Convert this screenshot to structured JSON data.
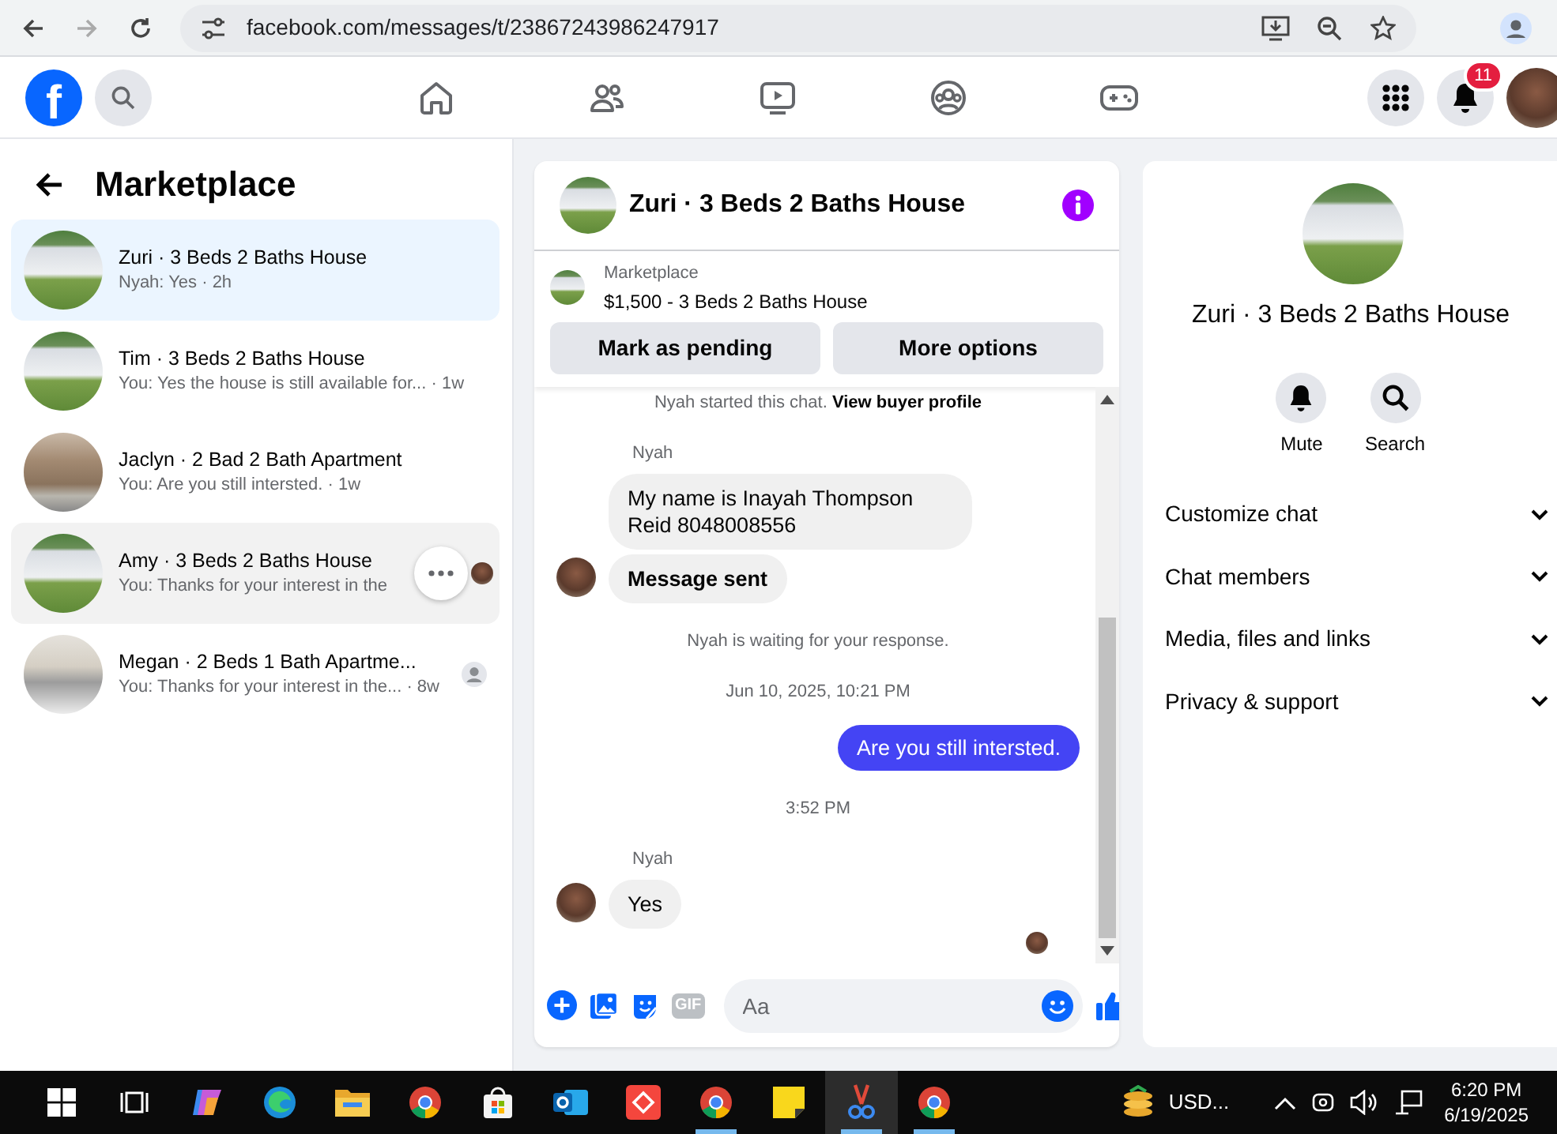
{
  "browser": {
    "url": "facebook.com/messages/t/23867243986247917"
  },
  "header": {
    "logo": "f",
    "notification_count": "11",
    "nav": [
      {
        "kind": "home",
        "selected": false
      },
      {
        "kind": "friends",
        "selected": false
      },
      {
        "kind": "video",
        "selected": false
      },
      {
        "kind": "groups",
        "selected": false
      },
      {
        "kind": "gaming",
        "selected": false
      }
    ]
  },
  "sidebar": {
    "title": "Marketplace",
    "conversations": [
      {
        "kind": "house",
        "title": "Zuri · 3 Beds 2 Baths House",
        "preview": "Nyah: Yes · 2h",
        "selected": true,
        "hovered": false,
        "read": false,
        "delivered": false
      },
      {
        "kind": "house",
        "title": "Tim · 3 Beds 2 Baths House",
        "preview": "You: Yes the house is still available for... · 1w",
        "selected": false,
        "hovered": false,
        "read": false,
        "delivered": false
      },
      {
        "kind": "apartment",
        "title": "Jaclyn · 2 Bad 2 Bath Apartment",
        "preview": "You: Are you still intersted. · 1w",
        "selected": false,
        "hovered": false,
        "read": false,
        "delivered": false
      },
      {
        "kind": "house",
        "title": "Amy · 3 Beds 2 Baths House",
        "preview": "You: Thanks for your interest in the",
        "selected": false,
        "hovered": true,
        "read": true,
        "delivered": false
      },
      {
        "kind": "kitchen",
        "title": "Megan · 2 Beds 1 Bath Apartme...",
        "preview": "You: Thanks for your interest in the... · 8w",
        "selected": false,
        "hovered": false,
        "read": false,
        "delivered": true
      }
    ]
  },
  "chat": {
    "title": "Zuri · 3 Beds 2 Baths House",
    "listing": {
      "label": "Marketplace",
      "price_title": "$1,500 - 3 Beds 2 Baths House",
      "buttons": [
        "Mark as pending",
        "More options"
      ]
    },
    "messages": [
      {
        "kind": "notice",
        "text": "Nyah started this chat.",
        "link": "View buyer profile"
      },
      {
        "kind": "sender",
        "text": "Nyah"
      },
      {
        "kind": "incoming",
        "text": "My name is Inayah Thompson Reid 8048008556",
        "avatar": false,
        "bold": false
      },
      {
        "kind": "incoming",
        "text": "Message sent",
        "avatar": true,
        "bold": true
      },
      {
        "kind": "notice",
        "text": "Nyah is waiting for your response."
      },
      {
        "kind": "timestamp",
        "text": "Jun 10, 2025, 10:21 PM"
      },
      {
        "kind": "outgoing",
        "text": "Are you still intersted."
      },
      {
        "kind": "timestamp",
        "text": "3:52 PM"
      },
      {
        "kind": "sender",
        "text": "Nyah"
      },
      {
        "kind": "incoming",
        "text": "Yes",
        "avatar": true,
        "bold": false
      },
      {
        "kind": "seen"
      }
    ],
    "composer": {
      "gif_label": "GIF",
      "placeholder": "Aa"
    }
  },
  "info_panel": {
    "title": "Zuri · 3 Beds 2 Baths House",
    "actions": [
      {
        "kind": "mute",
        "label": "Mute"
      },
      {
        "kind": "search",
        "label": "Search"
      }
    ],
    "sections": [
      {
        "label": "Customize chat",
        "expanded": false
      },
      {
        "label": "Chat members",
        "expanded": false
      },
      {
        "label": "Media, files and links",
        "expanded": false
      },
      {
        "label": "Privacy & support",
        "expanded": false
      }
    ]
  },
  "taskbar": {
    "apps": [
      {
        "kind": "start",
        "running": false,
        "selected": false
      },
      {
        "kind": "task-view",
        "running": false,
        "selected": false
      },
      {
        "kind": "copilot",
        "running": false,
        "selected": false
      },
      {
        "kind": "edge",
        "running": false,
        "selected": false
      },
      {
        "kind": "folder",
        "running": false,
        "selected": false
      },
      {
        "kind": "chrome",
        "running": false,
        "selected": false
      },
      {
        "kind": "store",
        "running": false,
        "selected": false
      },
      {
        "kind": "outlook",
        "running": false,
        "selected": false
      },
      {
        "kind": "red-app",
        "running": false,
        "selected": false
      },
      {
        "kind": "chrome",
        "running": true,
        "selected": false
      },
      {
        "kind": "note",
        "running": false,
        "selected": false
      },
      {
        "kind": "snip",
        "running": true,
        "selected": true
      },
      {
        "kind": "chrome",
        "running": true,
        "selected": false
      }
    ],
    "tray": {
      "currency": "USD...",
      "time": "6:20 PM",
      "date": "6/19/2025"
    }
  }
}
